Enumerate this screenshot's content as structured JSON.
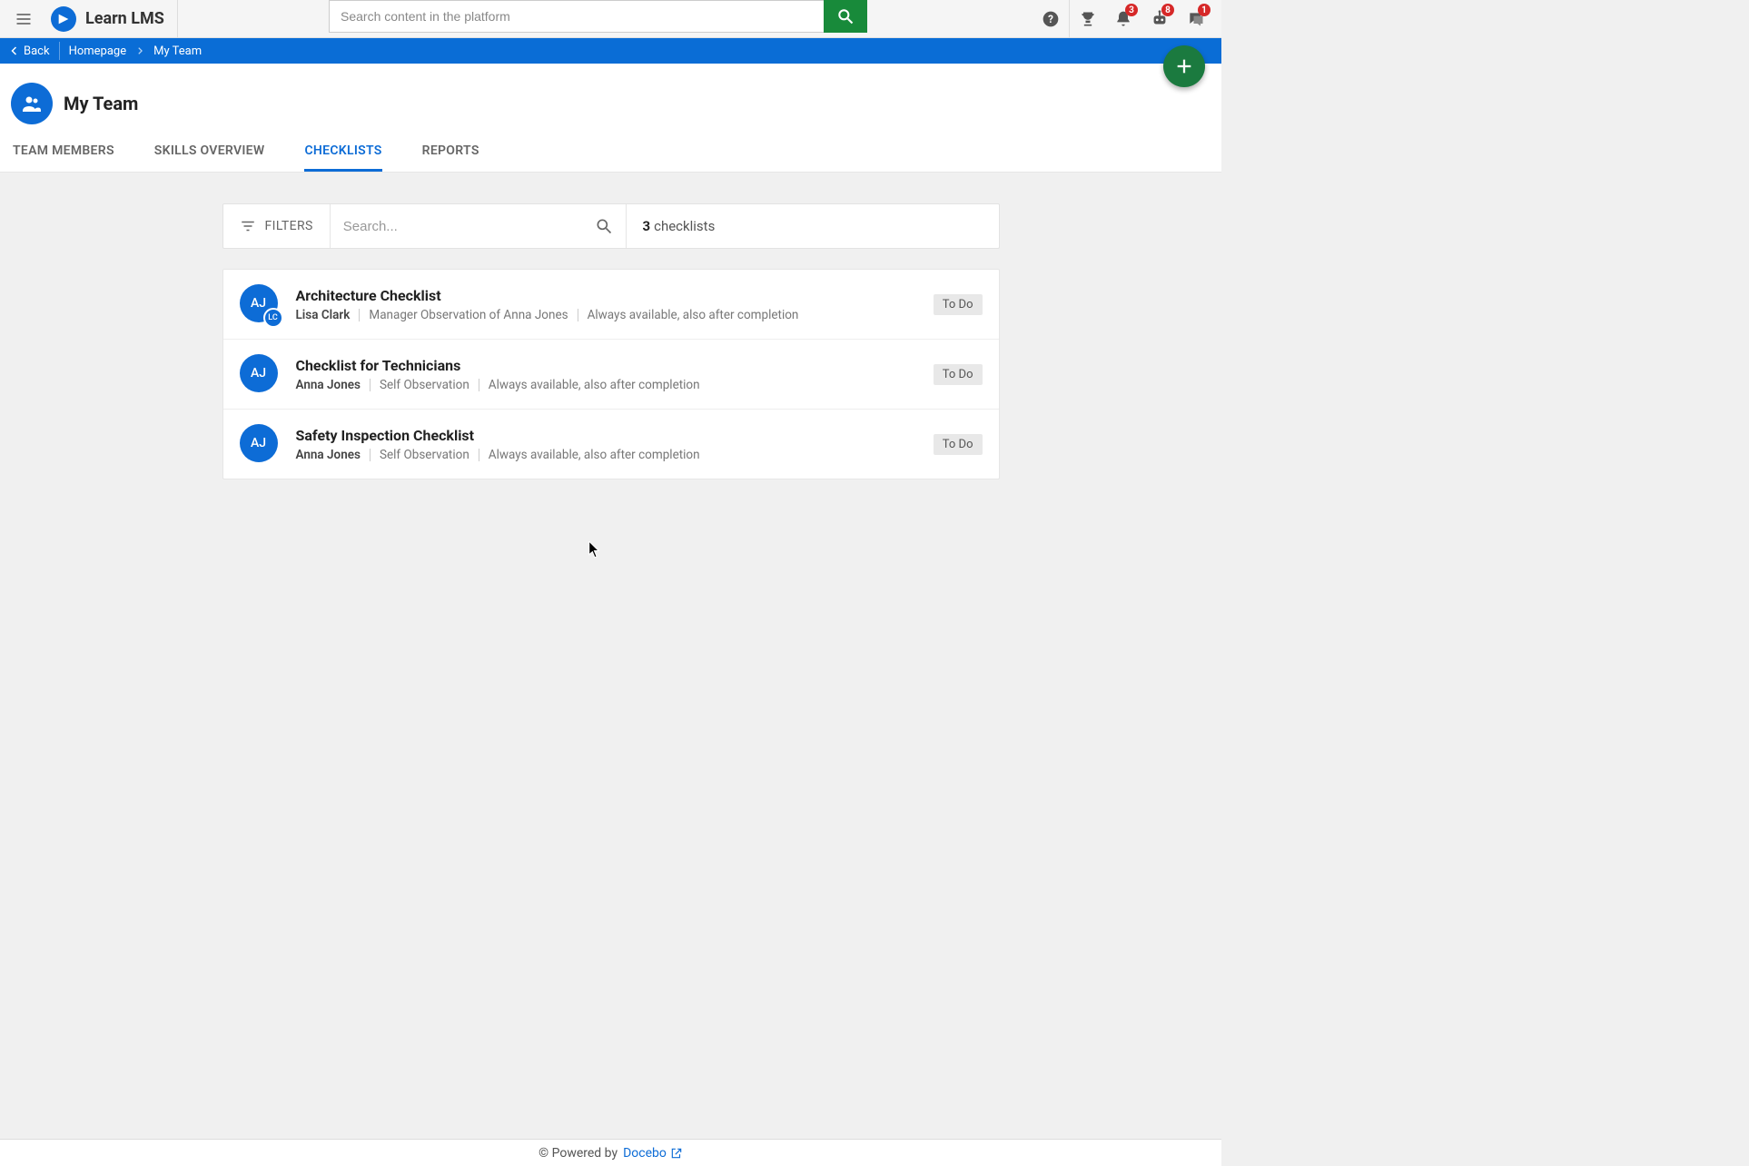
{
  "brand": {
    "name": "Learn LMS"
  },
  "header": {
    "search_placeholder": "Search content in the platform",
    "icons": {
      "notifications_badge": "3",
      "gamification_badge": "8",
      "messages_badge": "1"
    }
  },
  "breadcrumb": {
    "back": "Back",
    "items": [
      "Homepage",
      "My Team"
    ]
  },
  "page": {
    "title": "My Team"
  },
  "tabs": [
    {
      "label": "TEAM MEMBERS",
      "active": false
    },
    {
      "label": "SKILLS OVERVIEW",
      "active": false
    },
    {
      "label": "CHECKLISTS",
      "active": true
    },
    {
      "label": "REPORTS",
      "active": false
    }
  ],
  "filters": {
    "label": "FILTERS",
    "search_placeholder": "Search...",
    "count_number": "3",
    "count_label": "checklists"
  },
  "checklists": [
    {
      "title": "Architecture Checklist",
      "observer": "Lisa Clark",
      "observation": "Manager Observation of Anna Jones",
      "availability": "Always available, also after completion",
      "status": "To Do",
      "avatar_primary": "AJ",
      "avatar_secondary": "LC"
    },
    {
      "title": "Checklist for Technicians",
      "observer": "Anna Jones",
      "observation": "Self Observation",
      "availability": "Always available, also after completion",
      "status": "To Do",
      "avatar_primary": "AJ",
      "avatar_secondary": null
    },
    {
      "title": "Safety Inspection Checklist",
      "observer": "Anna Jones",
      "observation": "Self Observation",
      "availability": "Always available, also after completion",
      "status": "To Do",
      "avatar_primary": "AJ",
      "avatar_secondary": null
    }
  ],
  "footer": {
    "prefix": "© Powered by",
    "link": "Docebo"
  }
}
